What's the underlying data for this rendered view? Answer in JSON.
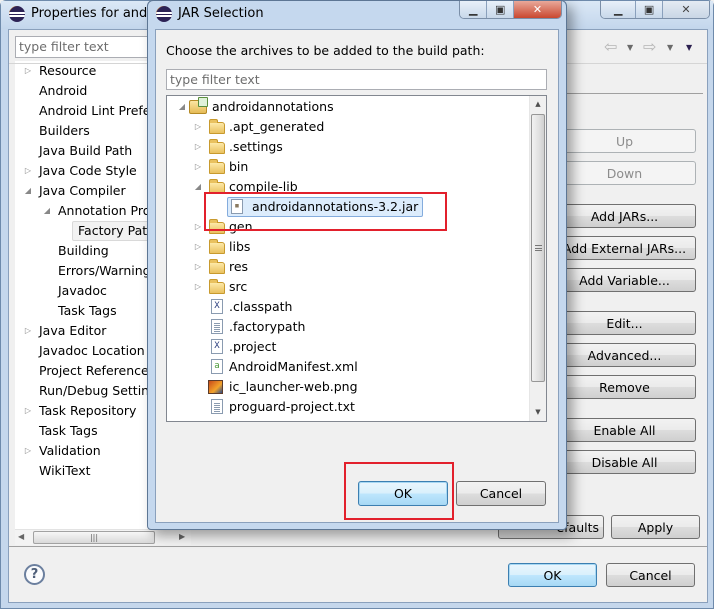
{
  "properties_window": {
    "title": "Properties for androi",
    "filter_placeholder": "type filter text",
    "tree": [
      {
        "label": "Resource",
        "expander": "collapsed",
        "level": 0
      },
      {
        "label": "Android",
        "expander": "none",
        "level": 0
      },
      {
        "label": "Android Lint Prefer",
        "expander": "none",
        "level": 0
      },
      {
        "label": "Builders",
        "expander": "none",
        "level": 0
      },
      {
        "label": "Java Build Path",
        "expander": "none",
        "level": 0
      },
      {
        "label": "Java Code Style",
        "expander": "collapsed",
        "level": 0
      },
      {
        "label": "Java Compiler",
        "expander": "expanded",
        "level": 0
      },
      {
        "label": "Annotation Proc",
        "expander": "expanded",
        "level": 1
      },
      {
        "label": "Factory Path",
        "expander": "none",
        "level": 2,
        "selected": true
      },
      {
        "label": "Building",
        "expander": "none",
        "level": 1
      },
      {
        "label": "Errors/Warning",
        "expander": "none",
        "level": 1
      },
      {
        "label": "Javadoc",
        "expander": "none",
        "level": 1
      },
      {
        "label": "Task Tags",
        "expander": "none",
        "level": 1
      },
      {
        "label": "Java Editor",
        "expander": "collapsed",
        "level": 0
      },
      {
        "label": "Javadoc Location",
        "expander": "none",
        "level": 0
      },
      {
        "label": "Project References",
        "expander": "none",
        "level": 0
      },
      {
        "label": "Run/Debug Setting",
        "expander": "none",
        "level": 0
      },
      {
        "label": "Task Repository",
        "expander": "collapsed",
        "level": 0
      },
      {
        "label": "Task Tags",
        "expander": "none",
        "level": 0
      },
      {
        "label": "Validation",
        "expander": "collapsed",
        "level": 0
      },
      {
        "label": "WikiText",
        "expander": "none",
        "level": 0
      }
    ],
    "nav": {
      "back": "⇦",
      "forward": "⇨",
      "dropdown": "▼"
    },
    "side_buttons": {
      "up": "Up",
      "down": "Down",
      "add_jars": "Add JARs...",
      "add_external_jars": "Add External JARs...",
      "add_variable": "Add Variable...",
      "edit": "Edit...",
      "advanced": "Advanced...",
      "remove": "Remove",
      "enable_all": "Enable All",
      "disable_all": "Disable All"
    },
    "restore_defaults": "Restore Defaults",
    "restore_defaults_visible": "efaults",
    "apply": "Apply",
    "ok": "OK",
    "cancel": "Cancel",
    "help_glyph": "?",
    "caption": {
      "minimize": "▁",
      "maximize": "▣",
      "close": "✕"
    }
  },
  "jar_dialog": {
    "title": "JAR Selection",
    "instruction": "Choose the archives to be added to the build path:",
    "filter_placeholder": "type filter text",
    "tree": [
      {
        "label": "androidannotations",
        "type": "project",
        "expander": "expanded",
        "level": 0
      },
      {
        "label": ".apt_generated",
        "type": "folder",
        "expander": "collapsed",
        "level": 1
      },
      {
        "label": ".settings",
        "type": "folder",
        "expander": "collapsed",
        "level": 1
      },
      {
        "label": "bin",
        "type": "folder",
        "expander": "collapsed",
        "level": 1
      },
      {
        "label": "compile-lib",
        "type": "folder",
        "expander": "expanded",
        "level": 1
      },
      {
        "label": "androidannotations-3.2.jar",
        "type": "jar",
        "expander": "none",
        "level": 2,
        "selected": true
      },
      {
        "label": "gen",
        "type": "folder",
        "expander": "collapsed",
        "level": 1
      },
      {
        "label": "libs",
        "type": "folder",
        "expander": "collapsed",
        "level": 1
      },
      {
        "label": "res",
        "type": "folder",
        "expander": "collapsed",
        "level": 1
      },
      {
        "label": "src",
        "type": "folder",
        "expander": "collapsed",
        "level": 1
      },
      {
        "label": ".classpath",
        "type": "xml",
        "expander": "none",
        "level": 1
      },
      {
        "label": ".factorypath",
        "type": "text",
        "expander": "none",
        "level": 1
      },
      {
        "label": ".project",
        "type": "xml",
        "expander": "none",
        "level": 1
      },
      {
        "label": "AndroidManifest.xml",
        "type": "manifest",
        "expander": "none",
        "level": 1
      },
      {
        "label": "ic_launcher-web.png",
        "type": "image",
        "expander": "none",
        "level": 1
      },
      {
        "label": "proguard-project.txt",
        "type": "text",
        "expander": "none",
        "level": 1
      }
    ],
    "ok": "OK",
    "cancel": "Cancel",
    "caption": {
      "minimize": "▁",
      "maximize": "▣",
      "close": "✕"
    },
    "highlight_color": "#e2202c"
  },
  "glyphs": {
    "collapsed": "▷",
    "expanded": "◢",
    "scroll_up": "▲",
    "scroll_down": "▼",
    "scroll_left": "◀",
    "scroll_right": "▶",
    "grip": "|||"
  }
}
